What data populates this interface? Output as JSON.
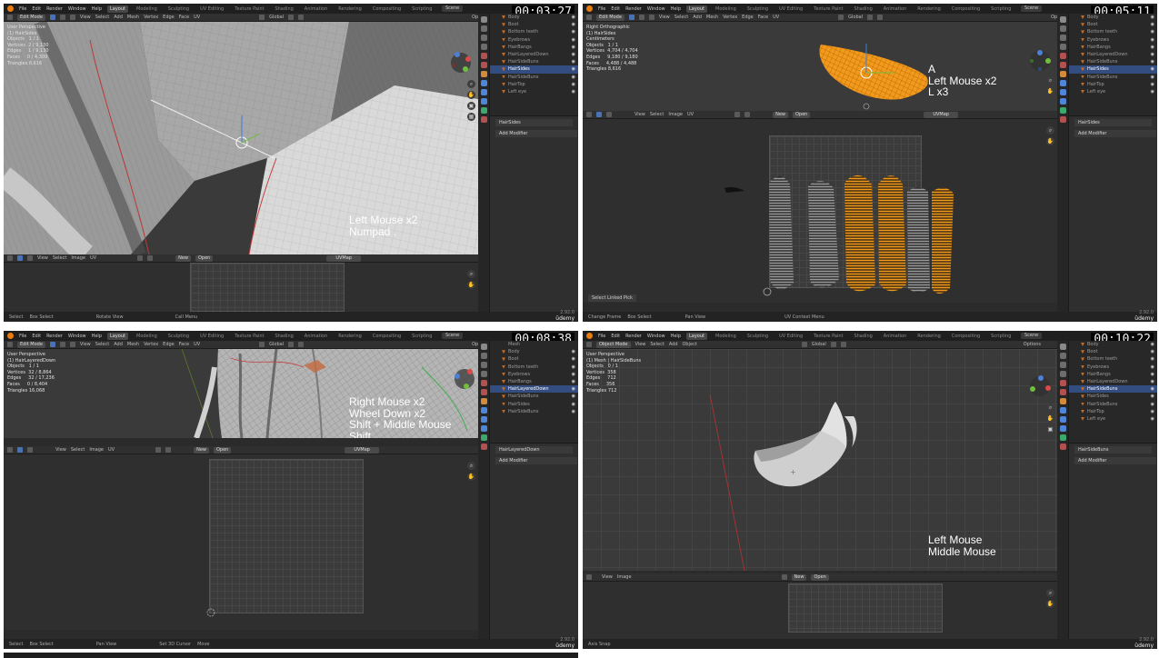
{
  "watermark": "ūdemy",
  "app": {
    "menus": [
      "File",
      "Edit",
      "Render",
      "Window",
      "Help"
    ],
    "workspaces": [
      "Layout",
      "Modeling",
      "Sculpting",
      "UV Editing",
      "Texture Paint",
      "Shading",
      "Animation",
      "Rendering",
      "Compositing",
      "Scripting"
    ],
    "active_workspace": "Layout",
    "scene": "Scene",
    "version": "2.92.0",
    "options": "Options",
    "transform_orientation": "Global"
  },
  "panels": [
    {
      "timestamp": "00:03:27",
      "mode": "Edit Mode",
      "viewport_menus": [
        "View",
        "Select",
        "Add",
        "Mesh",
        "Vertex",
        "Edge",
        "Face",
        "UV"
      ],
      "view_name": "User Perspective",
      "object_label": "(1) HairSides",
      "stats": [
        {
          "label": "Objects",
          "value": "1 / 1"
        },
        {
          "label": "Vertices",
          "value": "2 / 9,130"
        },
        {
          "label": "Edges",
          "value": "1 / 9,130"
        },
        {
          "label": "Faces",
          "value": "0 / 4,309"
        },
        {
          "label": "Triangles",
          "value": "8,616"
        }
      ],
      "overlay": "Left Mouse x2\nNumpad .",
      "uv_menus": [
        "View",
        "Select",
        "Image",
        "UV"
      ],
      "uv_new": "New",
      "uv_open": "Open",
      "uv_map": "UVMap",
      "outliner": [
        "Body",
        "Boot",
        "Bottom teeth",
        "Eyebrows",
        "HairBangs",
        "HairLayeredDown",
        "HairSideBuns",
        "HairSides",
        "HairSideBuns",
        "HairTop",
        "Left eye"
      ],
      "selected_item": "HairSides",
      "props_object": "HairSides",
      "add_modifier": "Add Modifier",
      "status": [
        "Select",
        "Box Select",
        "Rotate View",
        "Call Menu"
      ]
    },
    {
      "timestamp": "00:05:11",
      "mode": "Edit Mode",
      "viewport_menus": [
        "View",
        "Select",
        "Add",
        "Mesh",
        "Vertex",
        "Edge",
        "Face",
        "UV"
      ],
      "view_name": "Right Orthographic",
      "object_label": "(1) HairSides",
      "units_label": "Centimeters",
      "stats": [
        {
          "label": "Objects",
          "value": "1 / 1"
        },
        {
          "label": "Vertices",
          "value": "4,704 / 4,704"
        },
        {
          "label": "Edges",
          "value": "9,180 / 9,180"
        },
        {
          "label": "Faces",
          "value": "4,488 / 4,488"
        },
        {
          "label": "Triangles",
          "value": "8,616"
        }
      ],
      "overlay": "A\nLeft Mouse x2\nL x3",
      "uv_menus": [
        "View",
        "Select",
        "Image",
        "UV"
      ],
      "uv_new": "New",
      "uv_open": "Open",
      "uv_map": "UVMap",
      "uv_popup": "Select Linked Pick",
      "outliner": [
        "Body",
        "Boot",
        "Bottom teeth",
        "Eyebrows",
        "HairBangs",
        "HairLayeredDown",
        "HairSideBuns",
        "HairSides",
        "HairSideBuns",
        "HairTop",
        "Left eye"
      ],
      "selected_item": "HairSides",
      "props_object": "HairSides",
      "add_modifier": "Add Modifier",
      "status": [
        "Change Frame",
        "Box Select",
        "Pan View",
        "UV Context Menu"
      ]
    },
    {
      "timestamp": "00:08:38",
      "mode": "Edit Mode",
      "viewport_menus": [
        "View",
        "Select",
        "Add",
        "Mesh",
        "Vertex",
        "Edge",
        "Face",
        "UV"
      ],
      "view_name": "User Perspective",
      "object_label": "(1) HairLayeredDown",
      "stats": [
        {
          "label": "Objects",
          "value": "1 / 1"
        },
        {
          "label": "Vertices",
          "value": "32 / 8,864"
        },
        {
          "label": "Edges",
          "value": "32 / 17,236"
        },
        {
          "label": "Faces",
          "value": "0 / 8,404"
        },
        {
          "label": "Triangles",
          "value": "16,068"
        }
      ],
      "overlay": "Right Mouse x2\nWheel Down x2\nShift + Middle Mouse\nShift",
      "uv_menus": [
        "View",
        "Select",
        "Image",
        "UV"
      ],
      "uv_new": "New",
      "uv_open": "Open",
      "uv_map": "UVMap",
      "outliner_header": "Mesh",
      "outliner": [
        "Body",
        "Boot",
        "Bottom teeth",
        "Eyebrows",
        "HairBangs",
        "HairLayeredDown",
        "HairSideBuns",
        "HairSides",
        "HairSideBuns"
      ],
      "selected_item": "HairLayeredDown",
      "props_object": "HairLayeredDown",
      "add_modifier": "Add Modifier",
      "status": [
        "Select",
        "Box Select",
        "Pan View",
        "Set 3D Cursor",
        "Move"
      ]
    },
    {
      "timestamp": "00:10:22",
      "mode": "Object Mode",
      "viewport_menus": [
        "View",
        "Select",
        "Add",
        "Object"
      ],
      "view_name": "User Perspective",
      "object_label": "(1) Mesh | HairSideBuns",
      "stats": [
        {
          "label": "Objects",
          "value": "0 / 1"
        },
        {
          "label": "Vertices",
          "value": "358"
        },
        {
          "label": "Edges",
          "value": "712"
        },
        {
          "label": "Faces",
          "value": "356"
        },
        {
          "label": "Triangles",
          "value": "712"
        }
      ],
      "overlay": "Left Mouse\nMiddle Mouse",
      "uv_menus": [
        "View",
        "Image"
      ],
      "uv_new": "New",
      "uv_open": "Open",
      "outliner": [
        "Body",
        "Boot",
        "Bottom teeth",
        "Eyebrows",
        "HairBangs",
        "HairLayeredDown",
        "HairSideBuns",
        "HairSides",
        "HairSideBuns",
        "HairTop",
        "Left eye"
      ],
      "selected_item": "HairSideBuns",
      "props_object": "HairSideBuns",
      "add_modifier": "Add Modifier",
      "status": [
        "Axis Snap"
      ]
    }
  ]
}
